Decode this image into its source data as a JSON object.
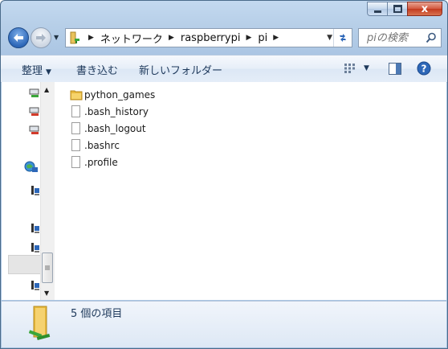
{
  "window": {
    "caption": {
      "minimize": "–",
      "maximize": "□",
      "close": "x"
    }
  },
  "navigation": {
    "breadcrumb": [
      {
        "label": "ネットワーク"
      },
      {
        "label": "raspberrypi"
      },
      {
        "label": "pi"
      }
    ],
    "search_placeholder": "piの検索"
  },
  "commandbar": {
    "organize_label": "整理",
    "write_label": "書き込む",
    "new_folder_label": "新しいフォルダー"
  },
  "files": [
    {
      "name": "python_games",
      "type": "folder"
    },
    {
      "name": ".bash_history",
      "type": "file"
    },
    {
      "name": ".bash_logout",
      "type": "file"
    },
    {
      "name": ".bashrc",
      "type": "file"
    },
    {
      "name": ".profile",
      "type": "file"
    }
  ],
  "details": {
    "summary": "5 個の項目"
  },
  "colors": {
    "accent": "#2d67b8",
    "folder": "#f0c64a",
    "help": "#2d67b8"
  }
}
